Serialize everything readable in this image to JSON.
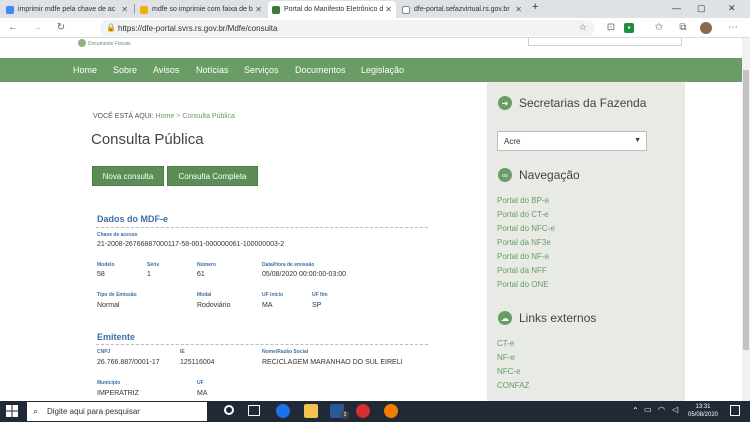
{
  "browser": {
    "tabs": [
      {
        "title": "imprimir mdfe pela chave de ac",
        "active": false
      },
      {
        "title": "mdfe so imprimie com faixa de b",
        "active": false
      },
      {
        "title": "Portal do Manifesto Eletrônico d",
        "active": true
      },
      {
        "title": "dfe-portal.sefazvirtual.rs.gov.br",
        "active": false
      }
    ],
    "new_tab": "+",
    "url": "https://dfe-portal.svrs.rs.gov.br/Mdfe/consulta"
  },
  "site": {
    "logo_text": "Documento Fiscais",
    "nav": [
      "Home",
      "Sobre",
      "Avisos",
      "Notícias",
      "Serviços",
      "Documentos",
      "Legislação"
    ]
  },
  "main": {
    "breadcrumb_label": "VOCÊ ESTÁ AQUI:",
    "breadcrumb_home": "Home",
    "breadcrumb_sep": ">",
    "breadcrumb_current": "Consulta Pública",
    "title": "Consulta Pública",
    "btn_new": "Nova consulta",
    "btn_full": "Consulta Completa",
    "mdfe": {
      "heading": "Dados do MDF-e",
      "chave_label": "Chave de acesso",
      "chave_value": "21-2008-26766887000117-58-001-000000061-100000003-2",
      "modelo_label": "Modelo",
      "modelo_value": "58",
      "serie_label": "Série",
      "serie_value": "1",
      "numero_label": "Número",
      "numero_value": "61",
      "data_label": "Data/Hora de emissão",
      "data_value": "05/08/2020 00:00:00-03:00",
      "tipo_label": "Tipo de Emissão",
      "tipo_value": "Normal",
      "modal_label": "Modal",
      "modal_value": "Rodoviário",
      "ufi_label": "UF início",
      "ufi_value": "MA",
      "uff_label": "UF fim",
      "uff_value": "SP"
    },
    "emitente": {
      "heading": "Emitente",
      "cnpj_label": "CNPJ",
      "cnpj_value": "26.766.887/0001-17",
      "ie_label": "IE",
      "ie_value": "125116004",
      "nome_label": "Nome/Razão Social",
      "nome_value": "RECICLAGEM MARANHAO DO SUL EIRELI",
      "mun_label": "Município",
      "mun_value": "IMPERATRIZ",
      "uf_label": "UF",
      "uf_value": "MA"
    }
  },
  "sidebar": {
    "secretarias_title": "Secretarias da Fazenda",
    "select_value": "Acre",
    "navegacao_title": "Navegação",
    "nav_links": [
      "Portal do BP-e",
      "Portal do CT-e",
      "Portal do NFC-e",
      "Portal da NF3e",
      "Portal do NF-e",
      "Portal da NFF",
      "Portal do ONE"
    ],
    "links_title": "Links externos",
    "external_links": [
      "CT-e",
      "NF-e",
      "NFC-e",
      "CONFAZ"
    ]
  },
  "taskbar": {
    "search_placeholder": "Digite aqui para pesquisar",
    "time": "13:31",
    "date": "05/08/2020",
    "badge": "2"
  },
  "colors": {
    "green": "#6a9c66",
    "blue_label": "#3d6fa3",
    "taskbar": "#1f2a36"
  }
}
